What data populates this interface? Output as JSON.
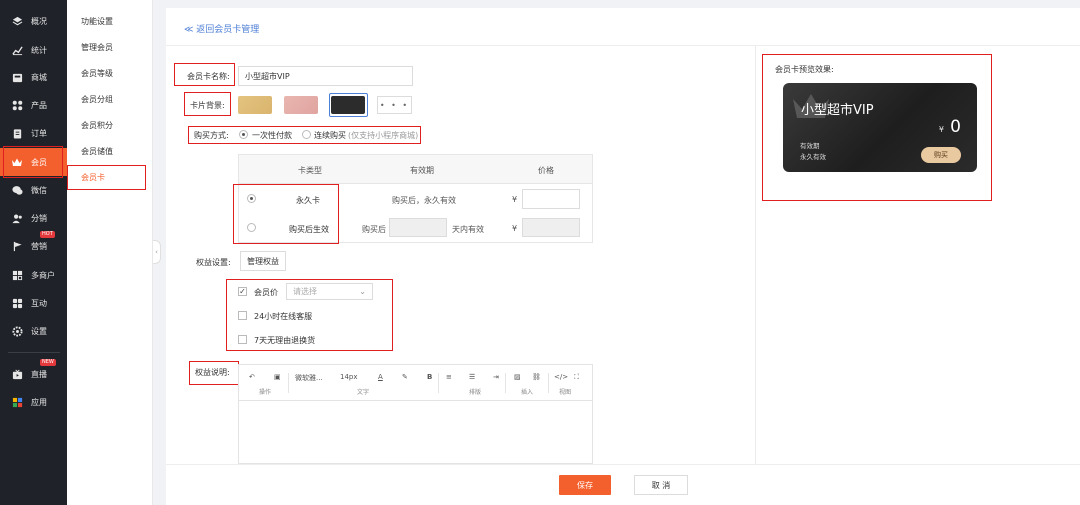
{
  "colors": {
    "accent": "#f4602d",
    "link": "#4e7fd6",
    "highlight_box": "#e02020",
    "sidebar_bg": "#1f2329"
  },
  "sidebar": {
    "items": [
      {
        "label": "概况",
        "icon": "layers-icon",
        "badge": ""
      },
      {
        "label": "统计",
        "icon": "chart-icon",
        "badge": ""
      },
      {
        "label": "商城",
        "icon": "store-icon",
        "badge": ""
      },
      {
        "label": "产品",
        "icon": "grid-icon",
        "badge": ""
      },
      {
        "label": "订单",
        "icon": "clipboard-icon",
        "badge": ""
      },
      {
        "label": "会员",
        "icon": "crown-icon",
        "badge": ""
      },
      {
        "label": "微信",
        "icon": "wechat-icon",
        "badge": ""
      },
      {
        "label": "分销",
        "icon": "users-icon",
        "badge": ""
      },
      {
        "label": "营销",
        "icon": "flag-icon",
        "badge": "HOT"
      },
      {
        "label": "多商户",
        "icon": "shop-icon",
        "badge": ""
      },
      {
        "label": "互动",
        "icon": "apps-icon",
        "badge": ""
      },
      {
        "label": "设置",
        "icon": "gear-icon",
        "badge": ""
      },
      {
        "label": "直播",
        "icon": "tv-icon",
        "badge": "NEW"
      },
      {
        "label": "应用",
        "icon": "color-grid-icon",
        "badge": ""
      }
    ]
  },
  "subnav": {
    "items": [
      "功能设置",
      "管理会员",
      "会员等级",
      "会员分组",
      "会员积分",
      "会员储值",
      "会员卡"
    ]
  },
  "header": {
    "back_link": "≪ 返回会员卡管理"
  },
  "form": {
    "name_label": "会员卡名称:",
    "name_value": "小型超市VIP",
    "bg_label": "卡片背景:",
    "bg_colors": [
      "#d9b46e",
      "#e0a4a0",
      "#2c2c2c"
    ],
    "more_label": "• • •",
    "purchase_label": "购买方式:",
    "purchase_option1": "一次性付款",
    "purchase_option2": "连续购买",
    "purchase_option2_note": "(仅支持小程序商城)",
    "table": {
      "col_type": "卡类型",
      "col_validity": "有效期",
      "col_price": "价格",
      "row1_type": "永久卡",
      "row1_validity": "购买后，永久有效",
      "row1_currency": "¥",
      "row2_type": "购买后生效",
      "row2_prefix": "购买后",
      "row2_suffix": "天内有效",
      "row2_currency": "¥"
    },
    "rights_label": "权益设置:",
    "manage_rights_button": "管理权益",
    "rights": {
      "item1": "会员价",
      "item1_placeholder": "请选择",
      "item2": "24小时在线客服",
      "item3": "7天无理由退换货"
    },
    "desc_label": "权益说明:"
  },
  "editor": {
    "font_name": "微软雅...",
    "font_size": "14px",
    "caption_operate": "操作",
    "caption_text": "文字",
    "caption_layout": "排版",
    "caption_insert": "插入",
    "caption_view": "视图"
  },
  "preview": {
    "label": "会员卡预览效果:",
    "card_title": "小型超市VIP",
    "currency": "¥",
    "price": "0",
    "validity_title": "有效期",
    "validity_value": "永久有效",
    "buy_button": "购买"
  },
  "footer": {
    "save": "保存",
    "cancel": "取 消"
  }
}
